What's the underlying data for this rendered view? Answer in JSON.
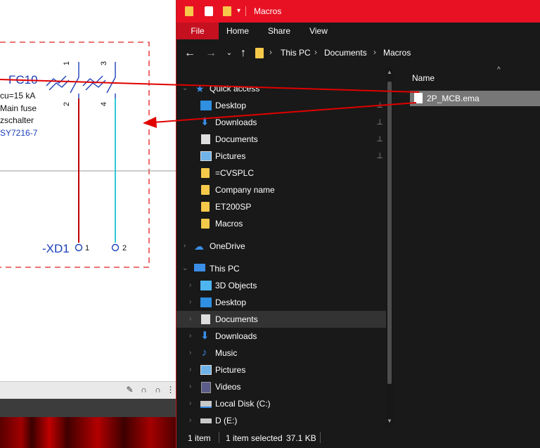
{
  "schematic": {
    "device_tag": "FC10",
    "spec_line": "cu=15 kA",
    "desc1": "Main fuse",
    "desc2": "zschalter",
    "part_no": "SY7216-7",
    "terminal_strip": "-XD1",
    "terminal1": "1",
    "terminal2": "2",
    "pin_top1": "1",
    "pin_top3": "3",
    "pin_bottom2": "2",
    "pin_bottom4": "4",
    "colors": {
      "wire_red": "#c00000",
      "wire_cyan": "#2ec9d3",
      "blue": "#1a3fb8",
      "frame": "#e02020"
    }
  },
  "explorer": {
    "title": "Macros",
    "ribbon_tabs": [
      "File",
      "Home",
      "Share",
      "View"
    ],
    "breadcrumb": [
      "This PC",
      "Documents",
      "Macros"
    ],
    "nav_items": [
      {
        "label": "Quick access",
        "icon": "star-icon",
        "level": 0
      },
      {
        "label": "Desktop",
        "icon": "desktop-icon",
        "level": 1,
        "pinned": true
      },
      {
        "label": "Downloads",
        "icon": "download-icon",
        "level": 1,
        "pinned": true
      },
      {
        "label": "Documents",
        "icon": "documents-icon",
        "level": 1,
        "pinned": true
      },
      {
        "label": "Pictures",
        "icon": "pictures-icon",
        "level": 1,
        "pinned": true
      },
      {
        "label": "=CVSPLC",
        "icon": "folder-icon",
        "level": 1
      },
      {
        "label": "Company name",
        "icon": "folder-icon",
        "level": 1
      },
      {
        "label": "ET200SP",
        "icon": "folder-icon",
        "level": 1
      },
      {
        "label": "Macros",
        "icon": "folder-icon",
        "level": 1
      },
      {
        "label": "OneDrive",
        "icon": "cloud-icon",
        "level": 0
      },
      {
        "label": "This PC",
        "icon": "computer-icon",
        "level": 0
      },
      {
        "label": "3D Objects",
        "icon": "cube-icon",
        "level": 1
      },
      {
        "label": "Desktop",
        "icon": "desktop-icon",
        "level": 1
      },
      {
        "label": "Documents",
        "icon": "documents-icon",
        "level": 1,
        "selected": true
      },
      {
        "label": "Downloads",
        "icon": "download-icon",
        "level": 1
      },
      {
        "label": "Music",
        "icon": "music-icon",
        "level": 1
      },
      {
        "label": "Pictures",
        "icon": "pictures-icon",
        "level": 1
      },
      {
        "label": "Videos",
        "icon": "videos-icon",
        "level": 1
      },
      {
        "label": "Local Disk (C:)",
        "icon": "disk-icon",
        "level": 1
      },
      {
        "label": "D (E:)",
        "icon": "drive-icon",
        "level": 1
      }
    ],
    "column_header": "Name",
    "files": [
      {
        "name": "2P_MCB.ema",
        "selected": true
      }
    ],
    "status": {
      "count": "1 item",
      "selection": "1 item selected",
      "size": "37.1 KB"
    },
    "colors": {
      "titlebar": "#e81123",
      "file_tab": "#c4101f",
      "background": "#191919"
    }
  }
}
